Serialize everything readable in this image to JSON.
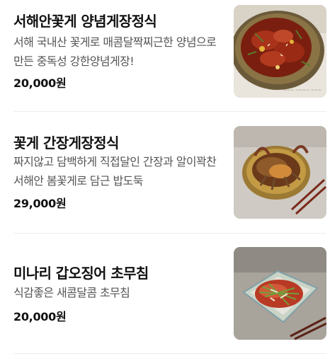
{
  "menu": {
    "items": [
      {
        "title": "서해안꽃게 양념게장정식",
        "description": "서해 국내산 꽃게로 매콤달짝찌근한 양념으로 만든 중독성 강한양념게장!",
        "price": "20,000원",
        "image": "spicy-crab-dish-photo"
      },
      {
        "title": "꽃게 간장게장정식",
        "description": "짜지않고 담백하게 직접달인 간장과 알이꽉찬 서해안 봄꽃게로 담근 밥도둑",
        "price": "29,000원",
        "image": "soy-crab-dish-photo"
      },
      {
        "title": "미나리 갑오징어 초무침",
        "description": "식감좋은 새콤달콤 초무침",
        "price": "20,000원",
        "image": "cuttlefish-salad-dish-photo"
      }
    ]
  },
  "colors": {
    "title": "#111111",
    "description": "#555555",
    "divider": "#ececec",
    "background": "#ffffff"
  }
}
